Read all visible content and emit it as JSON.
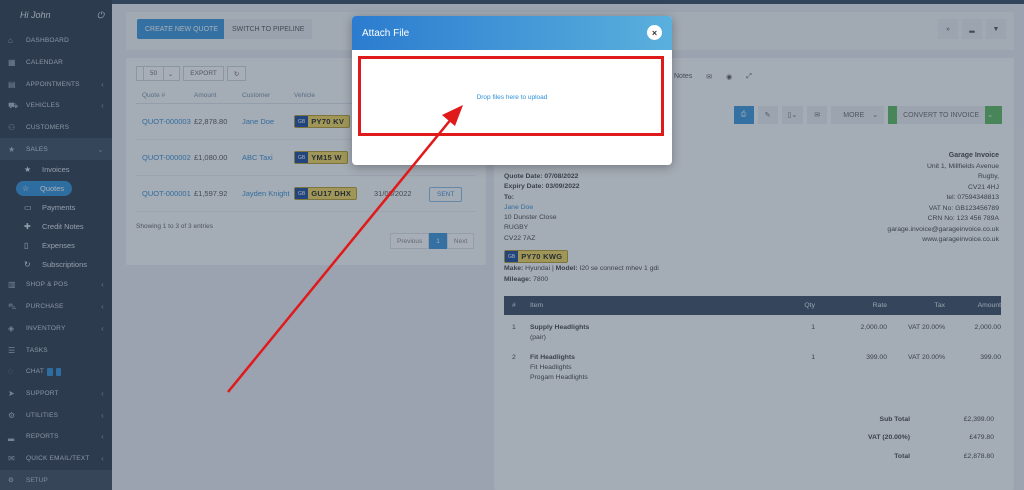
{
  "sidebar": {
    "greeting": "Hi John",
    "items": [
      {
        "label": "DASHBOARD",
        "icon": "home-icon"
      },
      {
        "label": "CALENDAR",
        "icon": "calendar-icon"
      },
      {
        "label": "APPOINTMENTS",
        "icon": "appointments-icon"
      },
      {
        "label": "VEHICLES",
        "icon": "car-icon"
      },
      {
        "label": "CUSTOMERS",
        "icon": "user-icon"
      },
      {
        "label": "SALES",
        "icon": "star-icon"
      }
    ],
    "sales_sub": [
      {
        "label": "Invoices",
        "icon": "star-icon"
      },
      {
        "label": "Quotes",
        "icon": "star-outline-icon"
      },
      {
        "label": "Payments",
        "icon": "card-icon"
      },
      {
        "label": "Credit Notes",
        "icon": "plus-icon"
      },
      {
        "label": "Expenses",
        "icon": "file-icon"
      },
      {
        "label": "Subscriptions",
        "icon": "refresh-icon"
      }
    ],
    "items2": [
      {
        "label": "SHOP & POS",
        "icon": "shop-icon"
      },
      {
        "label": "PURCHASE",
        "icon": "cart-icon"
      },
      {
        "label": "INVENTORY",
        "icon": "box-icon"
      },
      {
        "label": "TASKS",
        "icon": "tasks-icon"
      },
      {
        "label": "CHAT",
        "icon": "chat-icon"
      },
      {
        "label": "SUPPORT",
        "icon": "send-icon"
      },
      {
        "label": "UTILITIES",
        "icon": "cogs-icon"
      },
      {
        "label": "REPORTS",
        "icon": "chart-icon"
      },
      {
        "label": "QUICK EMAIL/TEXT",
        "icon": "mail-icon"
      }
    ],
    "setup": "SETUP"
  },
  "toolbar": {
    "create_quote": "CREATE NEW QUOTE",
    "switch_pipeline": "SWITCH TO PIPELINE"
  },
  "list": {
    "page_size": "50",
    "export": "EXPORT",
    "columns": [
      "Quote #",
      "Amount",
      "Customer",
      "Vehicle"
    ],
    "rows": [
      {
        "quote": "QUOT-000003",
        "amount": "£2,878.80",
        "customer": "Jane Doe",
        "plate": "PY70 KV",
        "date": "",
        "status": ""
      },
      {
        "quote": "QUOT-000002",
        "amount": "£1,080.00",
        "customer": "ABC Taxi",
        "plate": "YM15 W",
        "date": "",
        "status": ""
      },
      {
        "quote": "QUOT-000001",
        "amount": "£1,597.92",
        "customer": "Jayden Knight",
        "plate": "GU17 DHX",
        "date": "31/08/2022",
        "status": "SENT"
      }
    ],
    "plate_prefix": "GB",
    "showing": "Showing 1 to 3 of 3 entries",
    "pager": {
      "prev": "Previous",
      "current": "1",
      "next": "Next"
    }
  },
  "detail": {
    "tabs": [
      "Notes"
    ],
    "more": "MORE",
    "convert": "CONVERT TO INVOICE",
    "company": {
      "name": "Garage Invoice",
      "lines": [
        "Unit 1, Millfields Avenue",
        "Rugby,",
        "CV21 4HJ",
        "tel: 07594348813",
        "VAT No: GB123456789",
        "CRN No: 123 456 789A",
        "garage.invoice@garageinvoice.co.uk",
        "www.garageinvoice.co.uk"
      ]
    },
    "customer": {
      "quote_date": "Quote Date: 07/08/2022",
      "expiry_date": "Expiry Date: 03/09/2022",
      "to": "To:",
      "name": "Jane Doe",
      "lines": [
        "10 Dunster Close",
        "RUGBY",
        "CV22 7AZ"
      ]
    },
    "plate": "PY70 KWG",
    "make_label": "Make:",
    "make": "Hyundai",
    "model_label": "Model:",
    "model": "I20 se connect mhev 1 gdi",
    "mileage_label": "Mileage:",
    "mileage": "7800",
    "table_headers": [
      "#",
      "Item",
      "Qty",
      "Rate",
      "Tax",
      "Amount"
    ],
    "items": [
      {
        "n": "1",
        "title": "Supply Headlights",
        "sub": [
          "(pair)"
        ],
        "qty": "1",
        "rate": "2,000.00",
        "tax": "VAT 20.00%",
        "amount": "2,000.00"
      },
      {
        "n": "2",
        "title": "Fit Headlights",
        "sub": [
          "Fit Headlights",
          "Progam Headlights"
        ],
        "qty": "1",
        "rate": "399.00",
        "tax": "VAT 20.00%",
        "amount": "399.00"
      }
    ],
    "totals": [
      {
        "label": "Sub Total",
        "value": "£2,399.00"
      },
      {
        "label": "VAT (20.00%)",
        "value": "£479.80"
      },
      {
        "label": "Total",
        "value": "£2,878.80"
      }
    ]
  },
  "modal": {
    "title": "Attach File",
    "close": "×",
    "dropzone": "Drop files here to upload"
  },
  "annotation": {
    "box_color": "#e0191b",
    "arrow_color": "#e0191b"
  }
}
